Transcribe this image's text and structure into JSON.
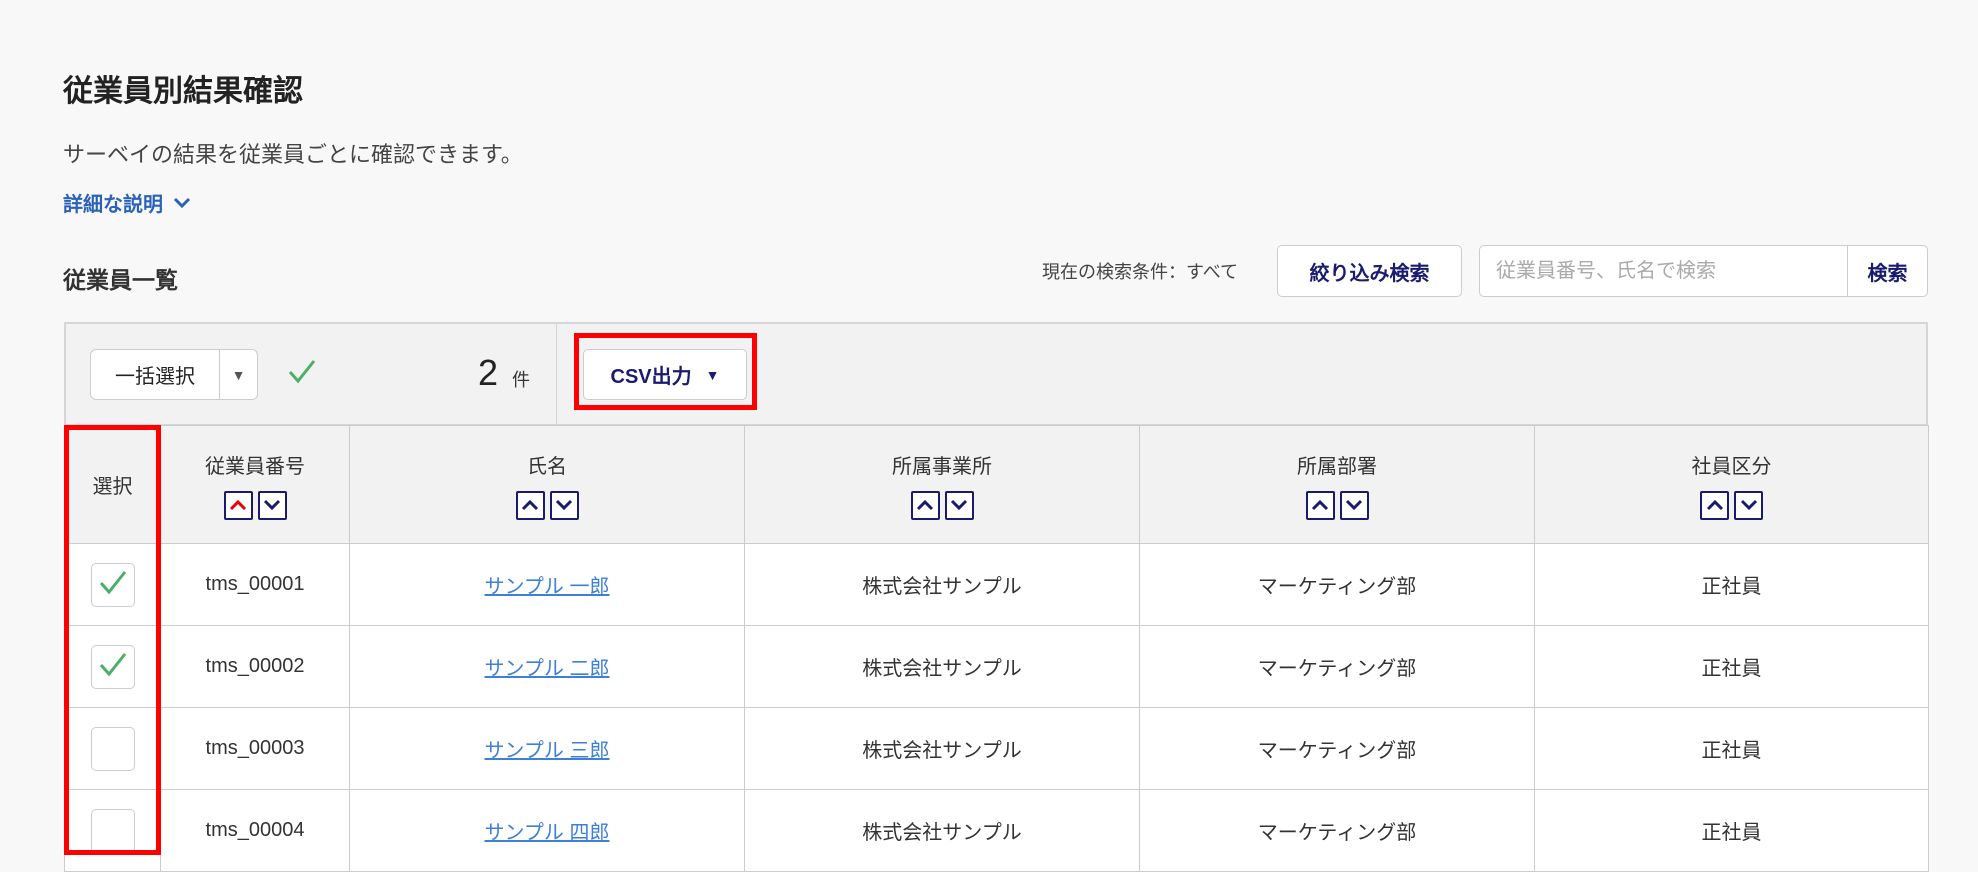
{
  "page": {
    "title": "従業員別結果確認",
    "description": "サーベイの結果を従業員ごとに確認できます。",
    "more_link": "詳細な説明"
  },
  "list": {
    "title": "従業員一覧",
    "search_condition": "現在の検索条件：すべて",
    "filter_button": "絞り込み検索",
    "search_placeholder": "従業員番号、氏名で検索",
    "search_button": "検索"
  },
  "toolbar": {
    "bulk_select": "一括選択",
    "selected_count": "2",
    "count_unit": "件",
    "csv_button": "CSV出力"
  },
  "colors": {
    "accent": "#1a1a6e",
    "link": "#3d7fd9",
    "check": "#4caf68",
    "highlight": "#ff0000"
  },
  "table": {
    "headers": [
      "選択",
      "従業員番号",
      "氏名",
      "所属事業所",
      "所属部署",
      "社員区分"
    ],
    "rows": [
      {
        "checked": true,
        "id": "tms_00001",
        "name": "サンプル 一郎",
        "office": "株式会社サンプル",
        "dept": "マーケティング部",
        "type": "正社員"
      },
      {
        "checked": true,
        "id": "tms_00002",
        "name": "サンプル 二郎",
        "office": "株式会社サンプル",
        "dept": "マーケティング部",
        "type": "正社員"
      },
      {
        "checked": false,
        "id": "tms_00003",
        "name": "サンプル 三郎",
        "office": "株式会社サンプル",
        "dept": "マーケティング部",
        "type": "正社員"
      },
      {
        "checked": false,
        "id": "tms_00004",
        "name": "サンプル 四郎",
        "office": "株式会社サンプル",
        "dept": "マーケティング部",
        "type": "正社員"
      }
    ]
  }
}
